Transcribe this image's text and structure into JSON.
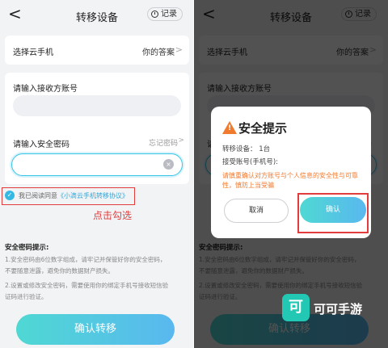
{
  "nav": {
    "title": "转移设备",
    "back": "<",
    "record": "记录"
  },
  "phone_row": {
    "label": "选择云手机",
    "value": "你的答案",
    "chevron": ">"
  },
  "form": {
    "account_label": "请输入接收方账号",
    "password_label": "请输入安全密码",
    "forgot": "忘记密码",
    "clear": "×"
  },
  "agree": {
    "text": "我已阅读同意",
    "link": "《小滴云手机转移协议》",
    "check": "✓"
  },
  "annotation": {
    "tap_check": "点击勾选"
  },
  "security": {
    "title": "安全密码提示:",
    "lines": [
      "1.安全密码由6位数字组成，请牢记并保管好你的安全密码，",
      "不要随意泄露，避免你的数据财产损失。",
      "2.设置或修改安全密码，需要使用你的绑定手机号接收短信验",
      "证码进行验证。"
    ]
  },
  "confirm_button": "确认转移",
  "dialog": {
    "title": "安全提示",
    "device_count": "转移设备：  1台",
    "account": "接受账号(手机号):",
    "warning": "请慎重确认对方账号与个人信息的安全性与可靠性，慎防上当受骗",
    "cancel": "取消",
    "ok": "确认"
  },
  "watermark": {
    "logo": "可",
    "text": "可可手游"
  },
  "colors": {
    "accent": "#39c3e6",
    "warning": "#f07a2e",
    "annotation": "#e23c3c"
  }
}
